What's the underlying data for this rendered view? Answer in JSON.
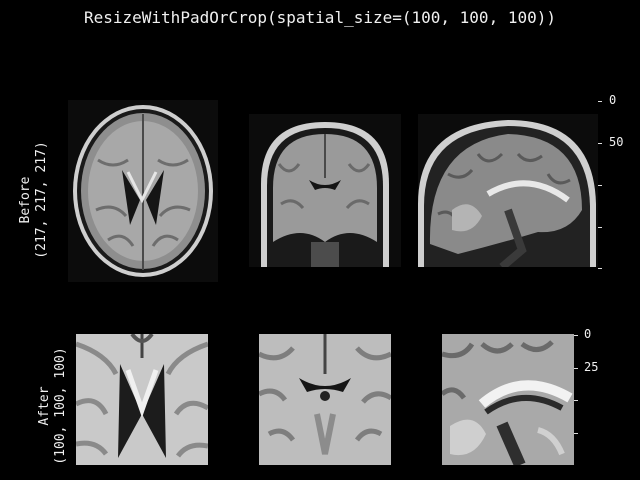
{
  "title": "ResizeWithPadOrCrop(spatial_size=(100, 100, 100))",
  "rows": [
    {
      "label_line1": "Before",
      "label_line2": "(217, 217, 217)",
      "ticks": [
        "0",
        "50"
      ]
    },
    {
      "label_line1": "After",
      "label_line2": "(100, 100, 100)",
      "ticks": [
        "0",
        "25"
      ]
    }
  ],
  "views": [
    "axial",
    "coronal",
    "sagittal"
  ]
}
